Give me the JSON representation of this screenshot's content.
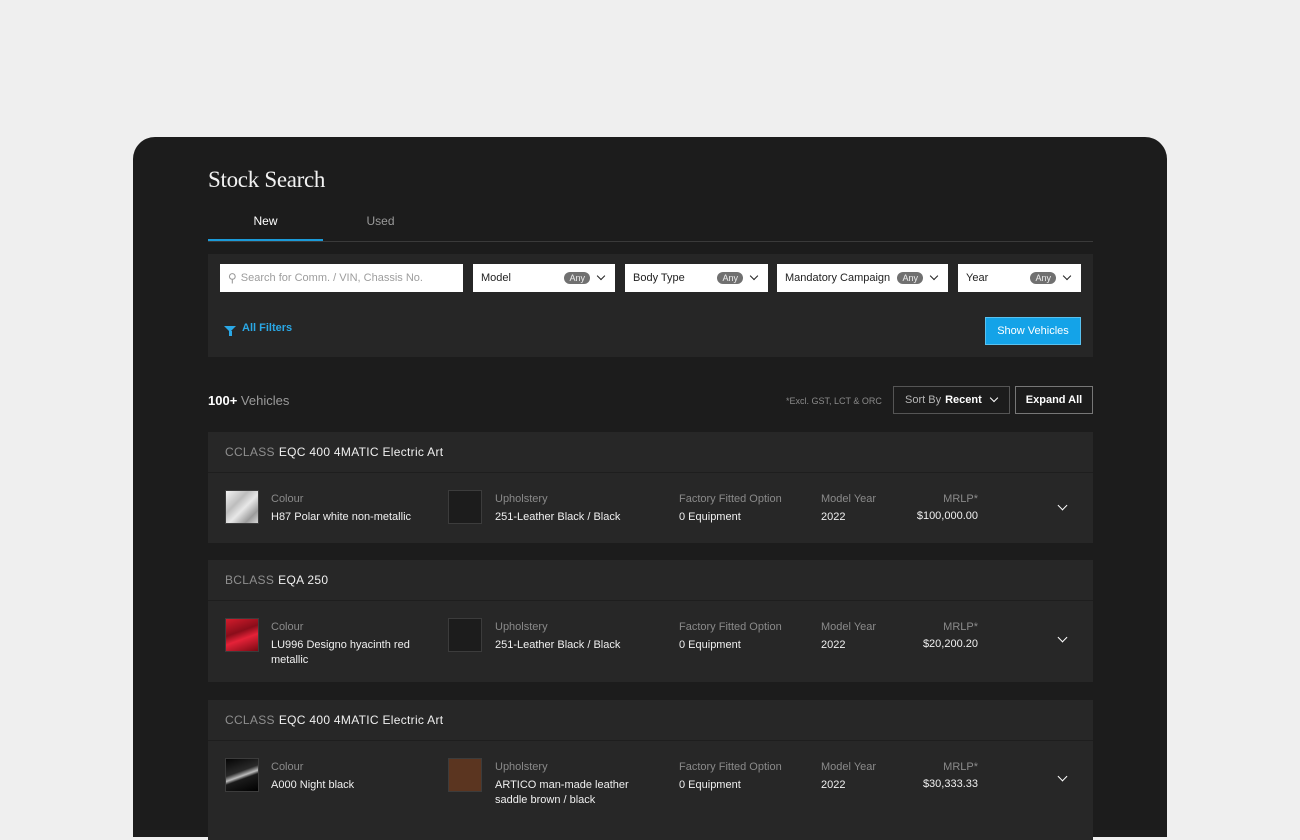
{
  "page": {
    "title": "Stock Search"
  },
  "tabs": [
    {
      "label": "New",
      "active": true
    },
    {
      "label": "Used",
      "active": false
    }
  ],
  "filters": {
    "search_placeholder": "Search for Comm. / VIN, Chassis No.",
    "selects": [
      {
        "label": "Model",
        "value": "Any"
      },
      {
        "label": "Body Type",
        "value": "Any"
      },
      {
        "label": "Mandatory Campaign",
        "value": "Any"
      },
      {
        "label": "Year",
        "value": "Any"
      }
    ],
    "all_filters_label": "All Filters",
    "show_button": "Show Vehicles"
  },
  "results": {
    "count_strong": "100+",
    "count_label": "Vehicles",
    "note": "*Excl. GST, LCT & ORC",
    "sort_label": "Sort By",
    "sort_value": "Recent",
    "expand_all": "Expand All"
  },
  "field_labels": {
    "colour": "Colour",
    "upholstery": "Upholstery",
    "factory": "Factory Fitted Option",
    "year": "Model Year",
    "price": "MRLP*"
  },
  "vehicles": [
    {
      "class": "CCLASS",
      "name": "EQC 400 4MATIC Electric Art",
      "colour": "H87 Polar white non-metallic",
      "colour_swatch": "#e4e4e4",
      "upholstery": "251-Leather Black / Black",
      "upholstery_swatch": "#1c1c1c",
      "factory": "0 Equipment",
      "year": "2022",
      "price": "$100,000.00"
    },
    {
      "class": "BCLASS",
      "name": "EQA 250",
      "colour": "LU996  Designo hyacinth red metallic",
      "colour_swatch": "#c8192a",
      "upholstery": "251-Leather Black / Black",
      "upholstery_swatch": "#1c1c1c",
      "factory": "0 Equipment",
      "year": "2022",
      "price": "$20,200.20"
    },
    {
      "class": "CCLASS",
      "name": "EQC 400 4MATIC Electric Art",
      "colour": "A000 Night black",
      "colour_swatch": "#0a0a0a",
      "upholstery": "ARTICO man-made leather saddle brown / black",
      "upholstery_swatch": "#5b3520",
      "factory": "0 Equipment",
      "year": "2022",
      "price": "$30,333.33"
    }
  ]
}
